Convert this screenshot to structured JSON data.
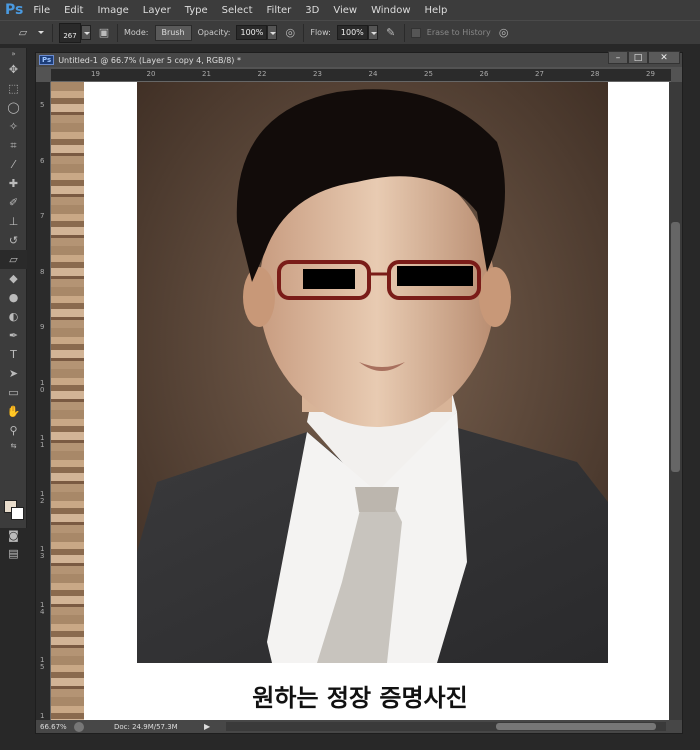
{
  "app": {
    "logo": "Ps"
  },
  "menu": [
    "File",
    "Edit",
    "Image",
    "Layer",
    "Type",
    "Select",
    "Filter",
    "3D",
    "View",
    "Window",
    "Help"
  ],
  "options": {
    "brush_size": "267",
    "mode_label": "Mode:",
    "mode_value": "Brush",
    "opacity_label": "Opacity:",
    "opacity_value": "100%",
    "flow_label": "Flow:",
    "flow_value": "100%",
    "erase_to_history": "Erase to History"
  },
  "document": {
    "tab_icon": "Ps",
    "title": "Untitled-1 @ 66.7% (Layer 5 copy 4, RGB/8) *",
    "hruler": [
      "19",
      "20",
      "21",
      "22",
      "23",
      "24",
      "25",
      "26",
      "27",
      "28",
      "29"
    ],
    "vruler": [
      "5",
      "6",
      "7",
      "8",
      "9",
      "10",
      "11",
      "12",
      "13",
      "14",
      "15",
      "1"
    ],
    "caption": "원하는 정장 증명사진"
  },
  "status": {
    "zoom": "66.67%",
    "doc": "Doc: 24.9M/57.3M"
  },
  "colors": {
    "foreground": "#e8dccc",
    "background": "#ffffff"
  }
}
